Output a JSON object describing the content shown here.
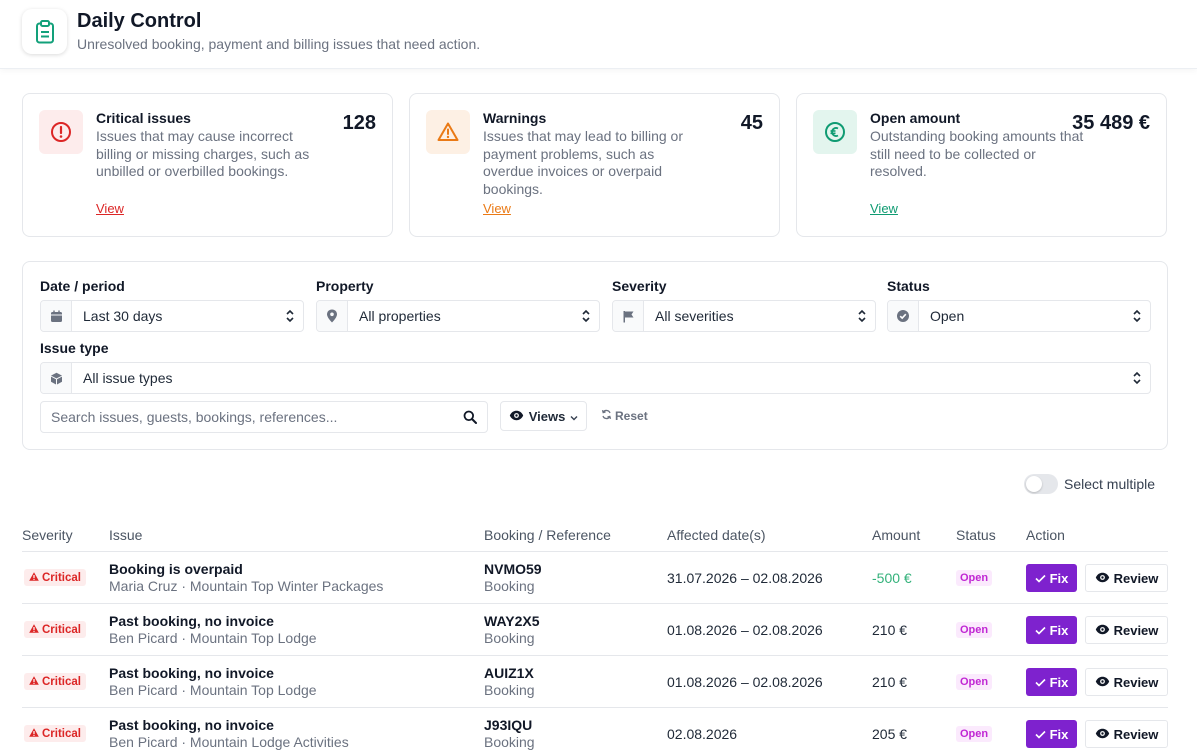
{
  "header": {
    "title": "Daily Control",
    "subtitle": "Unresolved booking, payment and billing issues that need action."
  },
  "cards": [
    {
      "title": "Critical issues",
      "description": "Issues that may cause incorrect billing or missing charges, such as unbilled or overbilled bookings.",
      "value": "128",
      "link": "View",
      "color": "#dc2626",
      "bg": "#fdecec",
      "icon": "alert-circle-icon"
    },
    {
      "title": "Warnings",
      "description": "Issues that may lead to billing or payment problems, such as overdue invoices or overpaid bookings.",
      "value": "45",
      "link": "View",
      "color": "#ea7a16",
      "bg": "#fdf0e4",
      "icon": "warning-triangle-icon"
    },
    {
      "title": "Open amount",
      "description": "Outstanding booking amounts that still need to be collected or resolved.",
      "value": "35 489 €",
      "link": "View",
      "color": "#0f9b72",
      "bg": "#e3f5ee",
      "icon": "euro-icon"
    }
  ],
  "filters": {
    "date": {
      "label": "Date / period",
      "value": "Last 30 days"
    },
    "property": {
      "label": "Property",
      "value": "All properties"
    },
    "severity": {
      "label": "Severity",
      "value": "All severities"
    },
    "status": {
      "label": "Status",
      "value": "Open"
    },
    "issue_type": {
      "label": "Issue type",
      "value": "All issue types"
    },
    "search_placeholder": "Search issues, guests, bookings, references...",
    "views_label": "Views",
    "reset_label": "Reset"
  },
  "select_multiple_label": "Select multiple",
  "table": {
    "columns": [
      "Severity",
      "Issue",
      "Booking / Reference",
      "Affected date(s)",
      "Amount",
      "Status",
      "Action"
    ],
    "rows": [
      {
        "severity": "Critical",
        "issue": "Booking is overpaid",
        "detail": "Maria Cruz · Mountain Top Winter Packages",
        "reference": "NVMO59",
        "ref_type": "Booking",
        "dates": "31.07.2026 – 02.08.2026",
        "amount": "-500 €",
        "status": "Open",
        "fix": "Fix",
        "review": "Review"
      },
      {
        "severity": "Critical",
        "issue": "Past booking, no invoice",
        "detail": "Ben Picard · Mountain Top Lodge",
        "reference": "WAY2X5",
        "ref_type": "Booking",
        "dates": "01.08.2026 – 02.08.2026",
        "amount": "210 €",
        "status": "Open",
        "fix": "Fix",
        "review": "Review"
      },
      {
        "severity": "Critical",
        "issue": "Past booking, no invoice",
        "detail": "Ben Picard · Mountain Top Lodge",
        "reference": "AUIZ1X",
        "ref_type": "Booking",
        "dates": "01.08.2026 – 02.08.2026",
        "amount": "210 €",
        "status": "Open",
        "fix": "Fix",
        "review": "Review"
      },
      {
        "severity": "Critical",
        "issue": "Past booking, no invoice",
        "detail": "Ben Picard · Mountain Lodge Activities",
        "reference": "J93IQU",
        "ref_type": "Booking",
        "dates": "02.08.2026",
        "amount": "205 €",
        "status": "Open",
        "fix": "Fix",
        "review": "Review"
      }
    ]
  }
}
